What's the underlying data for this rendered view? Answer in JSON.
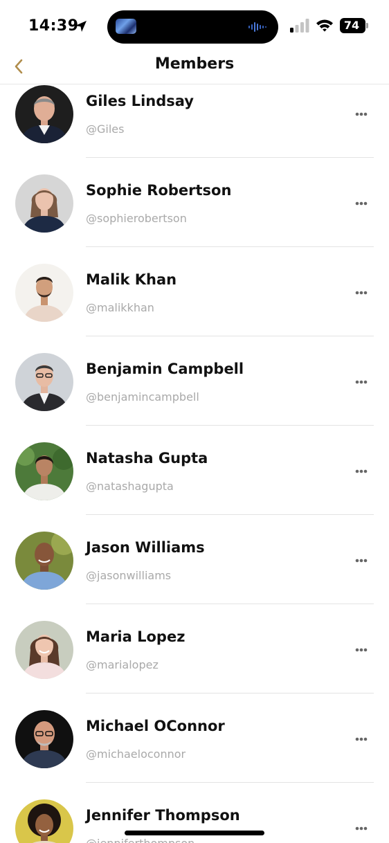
{
  "status_bar": {
    "time": "14:39",
    "battery": "74",
    "icons": [
      "location-arrow-icon",
      "cellular-signal-icon",
      "wifi-icon",
      "battery-icon"
    ]
  },
  "nav": {
    "title": "Members",
    "back_icon": "chevron-left-icon",
    "accent_color": "#b08d4c"
  },
  "members": [
    {
      "name": "Giles Lindsay",
      "handle": "@Giles"
    },
    {
      "name": "Sophie Robertson",
      "handle": "@sophierobertson"
    },
    {
      "name": "Malik Khan",
      "handle": "@malikkhan"
    },
    {
      "name": "Benjamin Campbell",
      "handle": "@benjamincampbell"
    },
    {
      "name": "Natasha Gupta",
      "handle": "@natashagupta"
    },
    {
      "name": "Jason Williams",
      "handle": "@jasonwilliams"
    },
    {
      "name": "Maria Lopez",
      "handle": "@marialopez"
    },
    {
      "name": "Michael OConnor",
      "handle": "@michaeloconnor"
    },
    {
      "name": "Jennifer Thompson",
      "handle": "@jenniferthompson"
    }
  ],
  "row_menu_icon": "more-horizontal-icon"
}
